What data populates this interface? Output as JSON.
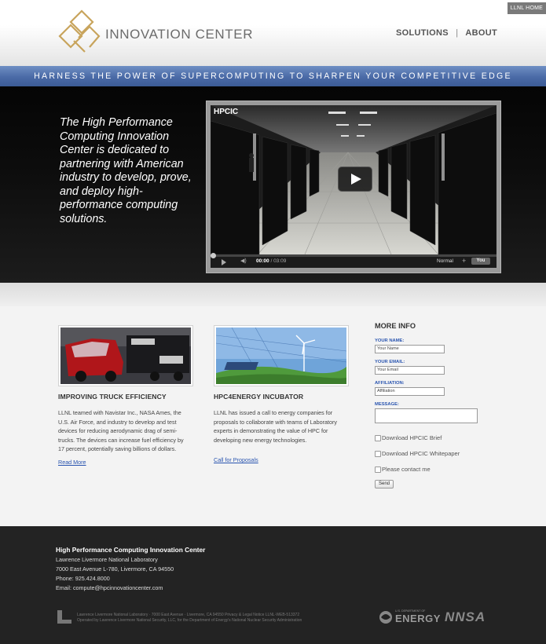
{
  "header": {
    "llnl_home": "LLNL HOME",
    "logo_text": "INNOVATION CENTER",
    "nav": [
      "SOLUTIONS",
      "ABOUT"
    ],
    "nav_separator": "|"
  },
  "banner": {
    "text": "HARNESS THE POWER OF SUPERCOMPUTING TO SHARPEN YOUR COMPETITIVE EDGE"
  },
  "hero": {
    "text": "The High Performance Computing Innovation Center is dedicated to partnering with American industry to develop, prove, and deploy high-performance computing solutions.",
    "video": {
      "title": "HPCIC",
      "current_time": "00:00",
      "duration": "03:09",
      "time_separator": "/",
      "quality": "Normal",
      "youtube": "You",
      "played_fraction": 0
    }
  },
  "columns": [
    {
      "title": "IMPROVING TRUCK EFFICIENCY",
      "body": "LLNL teamed with Navistar Inc., NASA Ames, the U.S. Air Force, and industry to develop and test devices for reducing aerodynamic drag of semi-trucks. The devices can increase fuel efficiency by 17 percent, potentially saving billions of dollars.",
      "link": "Read More"
    },
    {
      "title": "HPC4ENERGY INCUBATOR",
      "body": "LLNL has issued a call to energy companies for proposals to collaborate with teams of Laboratory experts in demonstrating the value of HPC for developing new energy technologies.",
      "link": "Call for Proposals"
    }
  ],
  "form": {
    "title": "MORE INFO",
    "name_label": "YOUR NAME:",
    "name_placeholder": "Your Name",
    "email_label": "YOUR EMAIL:",
    "email_placeholder": "Your Email",
    "affiliation_label": "AFFILIATION:",
    "affiliation_placeholder": "Affiliation",
    "message_label": "MESSAGE:",
    "checkboxes": [
      "Download HPCIC Brief",
      "Download HPCIC Whitepaper",
      "Please contact me"
    ],
    "send": "Send"
  },
  "footer": {
    "org": "High Performance Computing Innovation Center",
    "lines": [
      "Lawrence Livermore National Laboratory",
      "7000 East Avenue L-780, Livermore, CA 94550",
      "Phone: 925.424.8000",
      "Email: compute@hpcinnovationcenter.com"
    ],
    "legal1": "Lawrence Livermore National Laboratory · 7000 East Avenue · Livermore, CA 94550 Privacy & Legal Notice LLNL-WEB-513372",
    "legal2": "Operated by Lawrence Livermore National Security, LLC, for the Department of Energy's National Nuclear Security Administration",
    "energy_small": "U.S. DEPARTMENT OF",
    "energy": "ENERGY",
    "nnsa": "NNSA"
  },
  "colors": {
    "banner": "#4a6aa6",
    "link": "#2a55b0",
    "footer": "#232323",
    "logo_gold": "#c8a45c"
  }
}
